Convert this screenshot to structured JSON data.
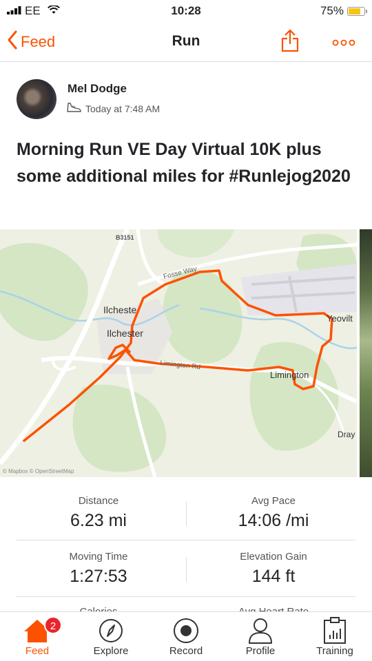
{
  "status_bar": {
    "carrier": "EE",
    "time": "10:28",
    "battery": "75%",
    "battery_level": 0.75
  },
  "navbar": {
    "back_label": "Feed",
    "title": "Run"
  },
  "activity": {
    "athlete": "Mel Dodge",
    "time": "Today at 7:48 AM",
    "title": "Morning Run VE Day Virtual 10K plus some additional miles for #Runlejog2020"
  },
  "map": {
    "labels": {
      "b3151": "B3151",
      "ilchester_upper": "Ilcheste",
      "ilchester": "Ilchester",
      "yeovilton": "Yeovilt",
      "limington": "Limington",
      "limington_rd": "Limington Rd",
      "fosse_way": "Fosse Way",
      "dray": "Dray",
      "attribution": "© Mapbox © OpenStreetMap"
    },
    "colors": {
      "route": "#fc5200",
      "green": "#d4e6c4",
      "water": "#a9d3e8",
      "road": "#ffffff",
      "land": "#eef0e4"
    }
  },
  "stats": {
    "distance_label": "Distance",
    "distance": "6.23 mi",
    "pace_label": "Avg Pace",
    "pace": "14:06 /mi",
    "moving_label": "Moving Time",
    "moving": "1:27:53",
    "elev_label": "Elevation Gain",
    "elev": "144 ft",
    "calories_label": "Calories",
    "heart_label": "Avg Heart Rate"
  },
  "tabs": {
    "feed": "Feed",
    "feed_badge": "2",
    "explore": "Explore",
    "record": "Record",
    "profile": "Profile",
    "training": "Training"
  },
  "icons": [
    "signal-icon",
    "wifi-icon",
    "battery-icon",
    "back-chevron-icon",
    "share-icon",
    "more-icon",
    "shoe-icon",
    "home-icon",
    "compass-icon",
    "record-icon",
    "profile-icon",
    "training-icon"
  ],
  "accent_color": "#fc5200"
}
